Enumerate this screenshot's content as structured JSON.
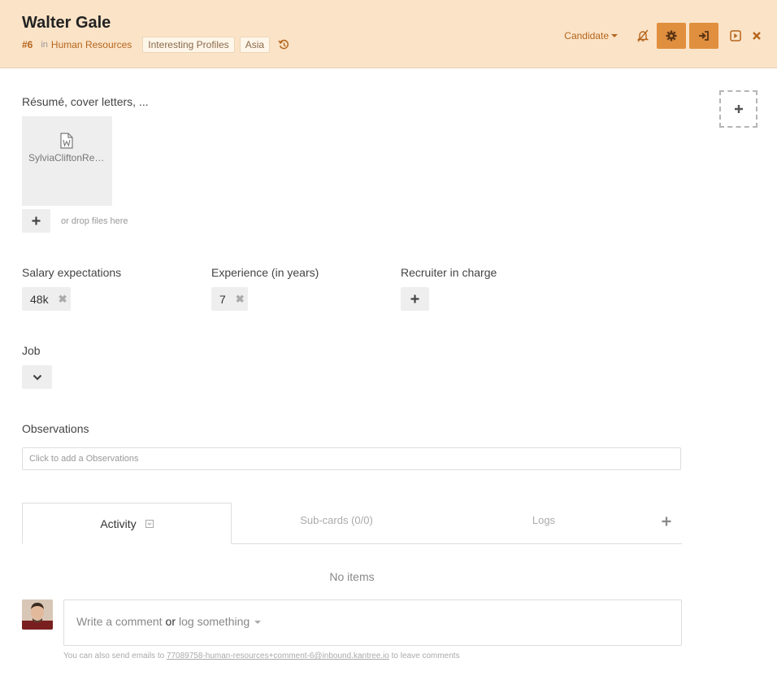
{
  "header": {
    "title": "Walter Gale",
    "card_id": "#6",
    "in_word": "in",
    "board": "Human Resources",
    "tags": [
      "Interesting Profiles",
      "Asia"
    ],
    "stage": "Candidate",
    "icons": [
      "history-icon",
      "bell-slash-icon",
      "gear-icon",
      "sign-in-icon",
      "play-square-icon",
      "close-icon"
    ],
    "colors": {
      "header_bg": "#fbe3c7",
      "accent": "#b5651d",
      "button": "#e08f3f"
    }
  },
  "files": {
    "label": "Résumé, cover letters, ...",
    "items": [
      {
        "name": "SylviaCliftonResume.docx",
        "icon": "word-file-icon"
      }
    ],
    "drop_hint": "or drop files here"
  },
  "fields": {
    "salary": {
      "label": "Salary expectations",
      "value": "48k"
    },
    "experience": {
      "label": "Experience (in years)",
      "value": "7"
    },
    "recruiter": {
      "label": "Recruiter in charge"
    },
    "job": {
      "label": "Job"
    },
    "observations": {
      "label": "Observations",
      "placeholder": "Click to add a Observations"
    }
  },
  "tabs": [
    {
      "label": "Activity",
      "active": true
    },
    {
      "label": "Sub-cards (0/0)",
      "active": false
    },
    {
      "label": "Logs",
      "active": false
    }
  ],
  "activity": {
    "empty": "No items",
    "comment_prompt": "Write a comment",
    "or_word": "or",
    "log_link": "log something",
    "email_note_prefix": "You can also send emails to",
    "email_address": "77089758-human-resources+comment-6@inbound.kantree.io",
    "email_note_suffix": "to leave comments"
  }
}
